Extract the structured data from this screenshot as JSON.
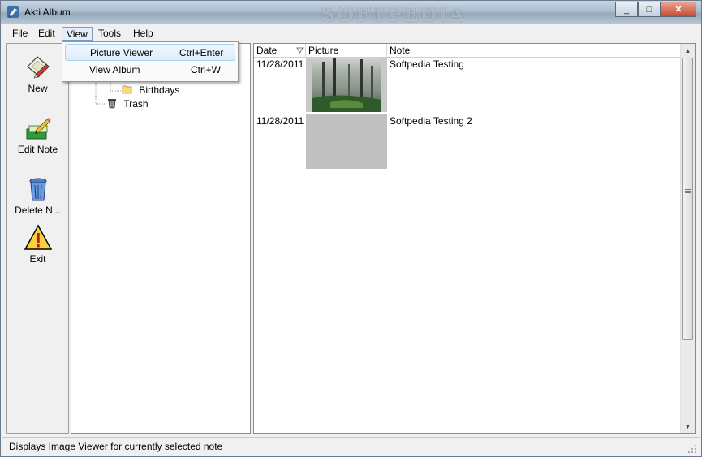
{
  "window": {
    "title": "Akti Album",
    "watermark": "SOFTPEDIA",
    "controls": [
      "_",
      "□",
      "✕"
    ]
  },
  "menubar": {
    "items": [
      "File",
      "Edit",
      "View",
      "Tools",
      "Help"
    ]
  },
  "view_menu": {
    "items": [
      {
        "label": "Picture Viewer",
        "shortcut": "Ctrl+Enter"
      },
      {
        "label": "View Album",
        "shortcut": "Ctrl+W"
      }
    ]
  },
  "toolbar": {
    "new_label": "New",
    "edit_label": "Edit Note",
    "delete_label": "Delete N...",
    "exit_label": "Exit"
  },
  "tree": {
    "items": [
      "Birthdays",
      "Trash"
    ]
  },
  "list": {
    "columns": [
      "Date",
      "Picture",
      "Note"
    ],
    "rows": [
      {
        "date": "11/28/2011",
        "note": "Softpedia Testing"
      },
      {
        "date": "11/28/2011",
        "note": "Softpedia Testing 2"
      }
    ]
  },
  "status": {
    "text": "Displays Image Viewer for currently selected note"
  },
  "colors": {
    "accent": "#cce4f7",
    "placeholder": "#c0c0c0"
  }
}
